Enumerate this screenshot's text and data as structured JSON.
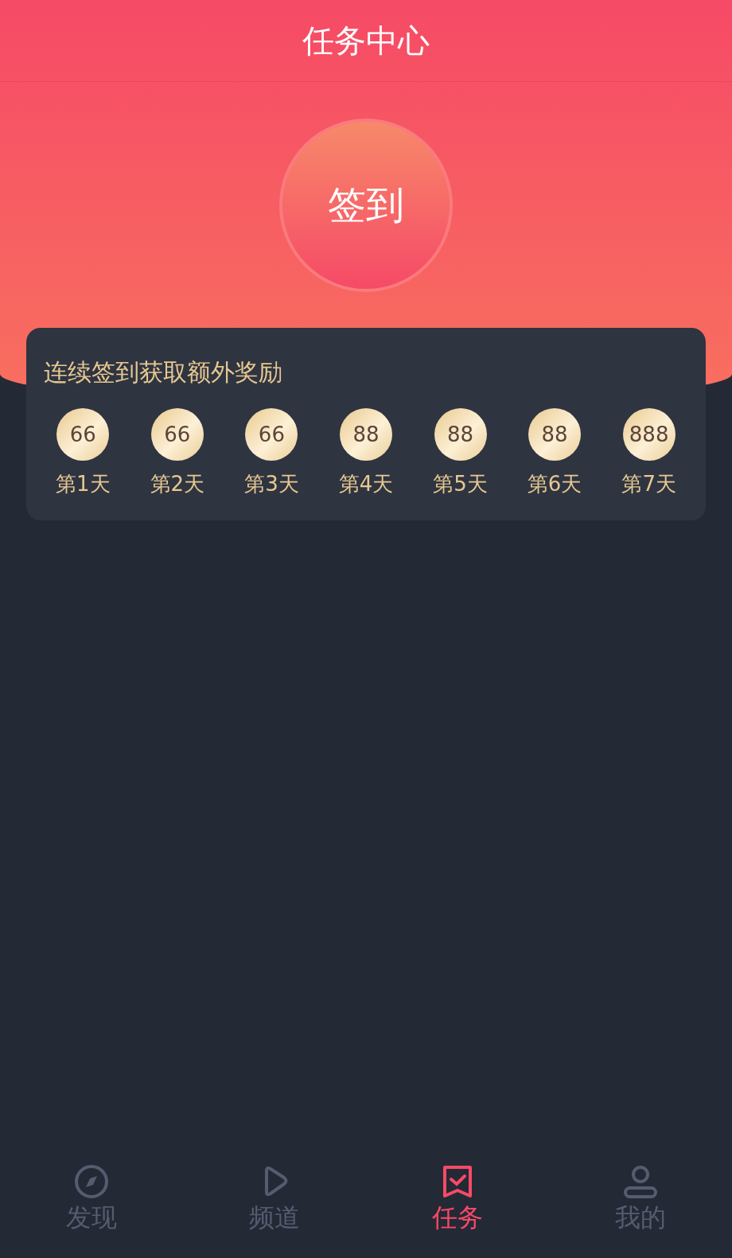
{
  "header": {
    "title": "任务中心"
  },
  "checkin_button": {
    "label": "签到"
  },
  "rewards": {
    "title": "连续签到获取额外奖励",
    "days": [
      {
        "coins": "66",
        "label": "第1天"
      },
      {
        "coins": "66",
        "label": "第2天"
      },
      {
        "coins": "66",
        "label": "第3天"
      },
      {
        "coins": "88",
        "label": "第4天"
      },
      {
        "coins": "88",
        "label": "第5天"
      },
      {
        "coins": "88",
        "label": "第6天"
      },
      {
        "coins": "888",
        "label": "第7天"
      }
    ]
  },
  "tab_bar": [
    {
      "kind": "discover",
      "label": "发现",
      "selected": false
    },
    {
      "kind": "channel",
      "label": "频道",
      "selected": false
    },
    {
      "kind": "task",
      "label": "任务",
      "selected": true
    },
    {
      "kind": "profile",
      "label": "我的",
      "selected": false
    }
  ]
}
